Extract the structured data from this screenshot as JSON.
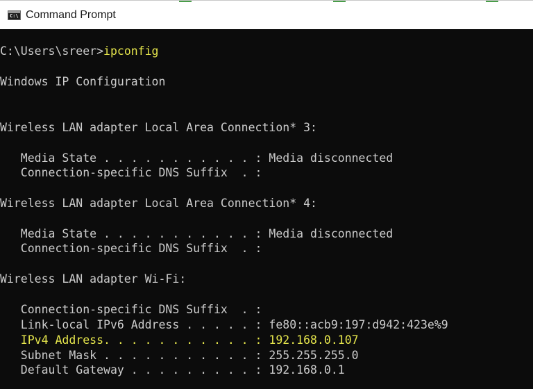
{
  "window": {
    "title": "Command Prompt",
    "icon": "cmd-console-icon",
    "icon_glyph": "C:\\"
  },
  "colors": {
    "console_bg": "#0c0c0c",
    "console_text": "#cccccc",
    "highlight": "#e5e54c",
    "titlebar_bg": "#ffffff"
  },
  "console": {
    "prompt": {
      "path": "C:\\Users\\sreer>",
      "command": "ipconfig"
    },
    "header": "Windows IP Configuration",
    "adapters": [
      {
        "title": "Wireless LAN adapter Local Area Connection* 3:",
        "lines": [
          "   Media State . . . . . . . . . . . : Media disconnected",
          "   Connection-specific DNS Suffix  . :"
        ]
      },
      {
        "title": "Wireless LAN adapter Local Area Connection* 4:",
        "lines": [
          "   Media State . . . . . . . . . . . : Media disconnected",
          "   Connection-specific DNS Suffix  . :"
        ]
      },
      {
        "title": "Wireless LAN adapter Wi-Fi:",
        "lines": [
          "   Connection-specific DNS Suffix  . :",
          "   Link-local IPv6 Address . . . . . : fe80::acb9:197:d942:423e%9",
          "   IPv4 Address. . . . . . . . . . . : 192.168.0.107",
          "   Subnet Mask . . . . . . . . . . . : 255.255.255.0",
          "   Default Gateway . . . . . . . . . : 192.168.0.1"
        ]
      }
    ]
  }
}
